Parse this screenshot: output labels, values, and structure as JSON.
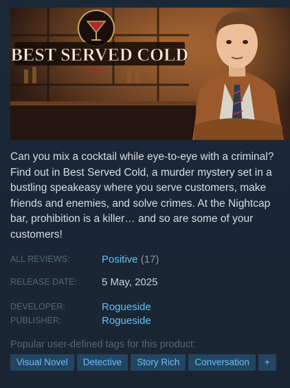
{
  "capsule": {
    "logo_text": "BEST SERVED COLD"
  },
  "description": "Can you mix a cocktail while eye-to-eye with a criminal? Find out in Best Served Cold, a murder mystery set in a bustling speakeasy where you serve customers, make friends and enemies, and solve crimes. At the Nightcap bar, prohibition is a killer… and so are some of your customers!",
  "reviews": {
    "label": "ALL REVIEWS:",
    "summary": "Positive",
    "count": "(17)"
  },
  "release": {
    "label": "RELEASE DATE:",
    "date": "5 May, 2025"
  },
  "developer": {
    "label": "DEVELOPER:",
    "name": "Rogueside"
  },
  "publisher": {
    "label": "PUBLISHER:",
    "name": "Rogueside"
  },
  "tags": {
    "title": "Popular user-defined tags for this product:",
    "items": [
      "Visual Novel",
      "Detective",
      "Story Rich",
      "Conversation"
    ],
    "more": "+"
  }
}
